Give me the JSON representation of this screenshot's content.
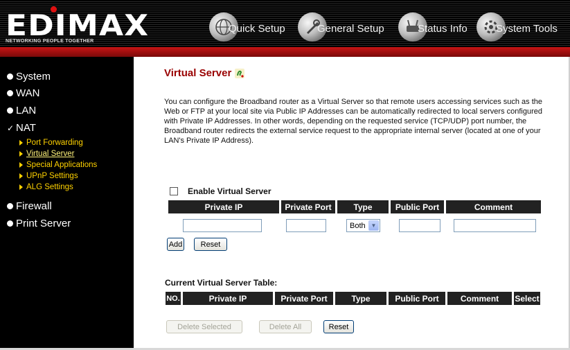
{
  "brand": {
    "logo_text": "EDIMAX",
    "tagline": "NETWORKING PEOPLE TOGETHER",
    "accent_color": "#cc1111"
  },
  "top_nav": [
    {
      "label": "Quick Setup",
      "icon": "globe-icon"
    },
    {
      "label": "General Setup",
      "icon": "tools-icon"
    },
    {
      "label": "Status Info",
      "icon": "router-icon"
    },
    {
      "label": "System Tools",
      "icon": "settings-icon"
    }
  ],
  "sidebar": {
    "main": [
      "System",
      "WAN",
      "LAN",
      "NAT",
      "Firewall",
      "Print Server"
    ],
    "nat_sub": [
      "Port Forwarding",
      "Virtual Server",
      "Special Applications",
      "UPnP Settings",
      "ALG Settings"
    ],
    "active_sub": "Virtual Server",
    "sub_color": "#ffd200"
  },
  "page": {
    "title": "Virtual Server",
    "title_color": "#990000",
    "description": "You can configure the Broadband router as a Virtual Server so that remote users accessing services such as the Web or FTP at your local site via Public IP Addresses can be automatically redirected to local servers configured with Private IP Addresses. In other words, depending on the requested service (TCP/UDP) port number, the Broadband router redirects the external service request to the appropriate internal server (located at one of your LAN's Private IP Address)."
  },
  "form": {
    "enable_label": "Enable Virtual Server",
    "enabled": false,
    "columns": [
      "Private IP",
      "Private Port",
      "Type",
      "Public Port",
      "Comment"
    ],
    "values": {
      "private_ip": "",
      "private_port": "",
      "type": "Both",
      "public_port": "",
      "comment": ""
    },
    "add_label": "Add",
    "reset_label": "Reset"
  },
  "table": {
    "heading": "Current Virtual Server Table:",
    "columns": [
      "NO.",
      "Private IP",
      "Private Port",
      "Type",
      "Public Port",
      "Comment",
      "Select"
    ],
    "rows": [],
    "delete_selected_label": "Delete Selected",
    "delete_all_label": "Delete All",
    "reset_label": "Reset"
  }
}
